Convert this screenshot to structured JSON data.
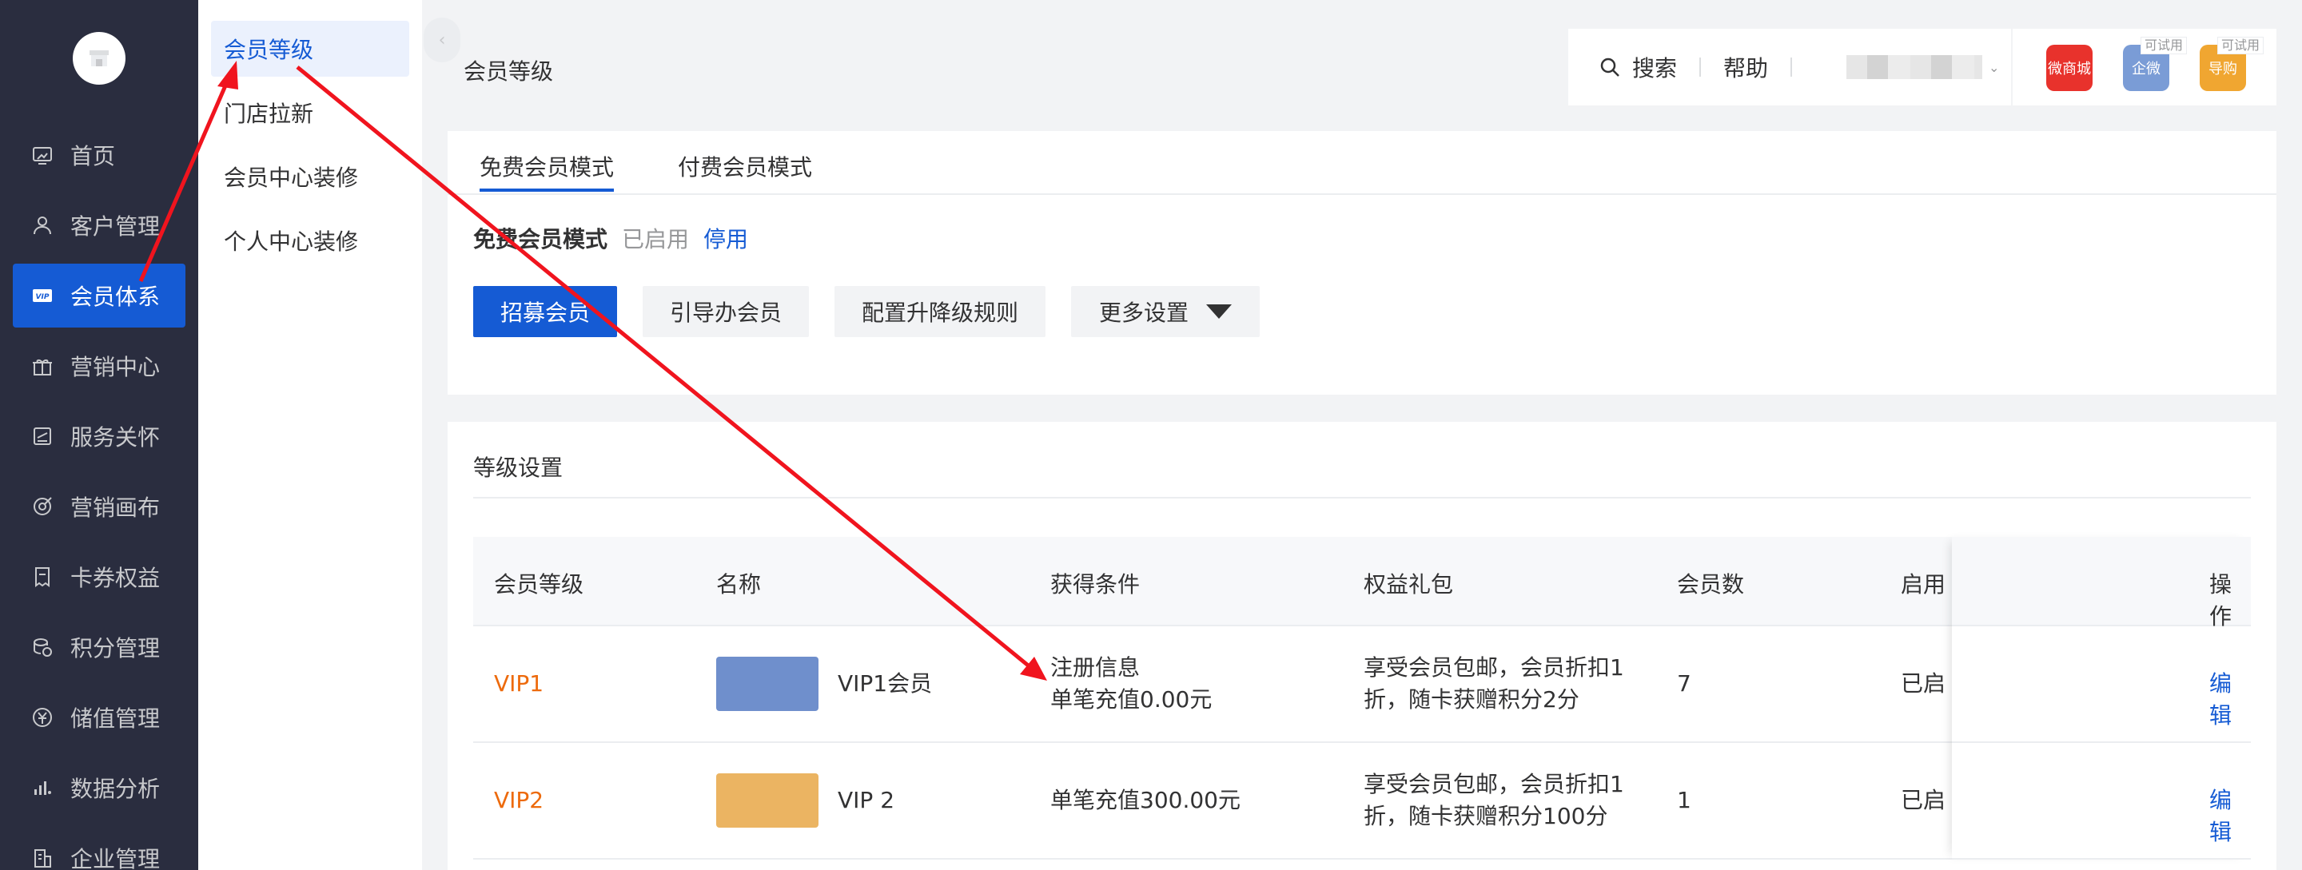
{
  "sidebar": {
    "items": [
      {
        "label": "首页",
        "icon": "home-icon"
      },
      {
        "label": "客户管理",
        "icon": "user-icon"
      },
      {
        "label": "会员体系",
        "icon": "vip-icon"
      },
      {
        "label": "营销中心",
        "icon": "gift-icon"
      },
      {
        "label": "服务关怀",
        "icon": "service-icon"
      },
      {
        "label": "营销画布",
        "icon": "canvas-icon"
      },
      {
        "label": "卡券权益",
        "icon": "coupon-icon"
      },
      {
        "label": "积分管理",
        "icon": "points-icon"
      },
      {
        "label": "储值管理",
        "icon": "wallet-icon"
      },
      {
        "label": "数据分析",
        "icon": "chart-icon"
      },
      {
        "label": "企业管理",
        "icon": "building-icon"
      }
    ],
    "active_index": 2
  },
  "submenu": {
    "items": [
      "会员等级",
      "门店拉新",
      "会员中心装修",
      "个人中心装修"
    ],
    "active_index": 0
  },
  "header": {
    "title": "会员等级",
    "search_label": "搜索",
    "help_label": "帮助",
    "apps": [
      {
        "name": "微商城",
        "color": "#e8322c",
        "tag": ""
      },
      {
        "name": "企微",
        "color": "#7a9cd6",
        "tag": "可试用"
      },
      {
        "name": "导购",
        "color": "#f0a631",
        "tag": "可试用"
      }
    ]
  },
  "mode_card": {
    "tabs": [
      "免费会员模式",
      "付费会员模式"
    ],
    "active_tab": 0,
    "mode_label": "免费会员模式",
    "mode_status": "已启用",
    "mode_action": "停用",
    "buttons": {
      "recruit": "招募会员",
      "guide": "引导办会员",
      "rules": "配置升降级规则",
      "more": "更多设置"
    }
  },
  "level_card": {
    "title": "等级设置",
    "columns": [
      "会员等级",
      "名称",
      "获得条件",
      "权益礼包",
      "会员数",
      "启用",
      "操作"
    ],
    "rows": [
      {
        "level": "VIP1",
        "name": "VIP1会员",
        "card_color": "#6f8fcc",
        "condition_1": "注册信息",
        "condition_2": "单笔充值0.00元",
        "benefit_1": "享受会员包邮，会员折扣1",
        "benefit_2": "折，随卡获赠积分2分",
        "members": "7",
        "status": "已启",
        "action": "编辑"
      },
      {
        "level": "VIP2",
        "name": "VIP 2",
        "card_color": "#ebb462",
        "condition_1": "单笔充值300.00元",
        "condition_2": "",
        "benefit_1": "享受会员包邮，会员折扣1",
        "benefit_2": "折，随卡获赠积分100分",
        "members": "1",
        "status": "已启",
        "action": "编辑"
      }
    ]
  },
  "colors": {
    "brand_blue": "#155bd4",
    "sidebar_bg": "#2a2d3f",
    "level_orange": "#ed6a0c",
    "annotation_red": "#f0141e"
  }
}
